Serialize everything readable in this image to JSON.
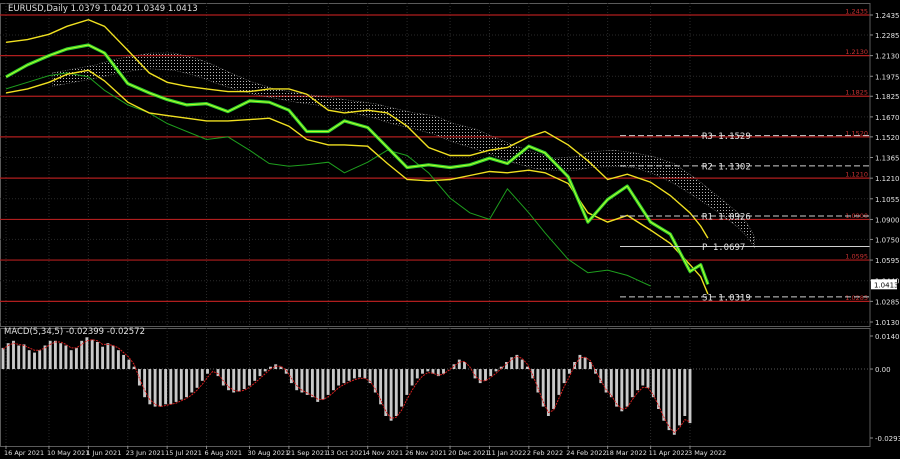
{
  "header": {
    "symbol_line": "EURUSD,Daily  1.0379 1.0420 1.0349 1.0413",
    "macd_line": "MACD(5,34,5) -0.02399 -0.02572"
  },
  "colors": {
    "background": "#000000",
    "grid": "#2a2a2a",
    "price": "#2fd02f",
    "price_highlight": "#b7ff2a",
    "bollinger": "#f0e020",
    "ichimoku_cloud": "#c8c8c8",
    "chikou": "#1e9e1e",
    "level_line": "#b01e1e",
    "level_label": "#c83232",
    "pivot_line": "#d0d0d0",
    "pivot_text": "#e0e0e0",
    "macd_hist": "#c8c8c8",
    "macd_signal": "#d82020",
    "axis_text": "#e0e0e0",
    "current_price_box": "#ffffff"
  },
  "chart_data": [
    {
      "type": "line",
      "panel": "price",
      "symbol": "EURUSD",
      "timeframe": "Daily",
      "ohlc_last": {
        "open": 1.0379,
        "high": 1.042,
        "low": 1.0349,
        "close": 1.0413
      },
      "current_price_label": "1.0413",
      "ylim": [
        1.013,
        1.2435
      ],
      "y_ticks": [
        "1.2435",
        "1.2285",
        "1.2130",
        "1.1975",
        "1.1825",
        "1.1670",
        "1.1520",
        "1.1365",
        "1.1210",
        "1.1055",
        "1.0900",
        "1.0750",
        "1.0595",
        "1.0440",
        "1.0285",
        "1.0130"
      ],
      "x_ticks": [
        "16 Apr 2021",
        "10 May 2021",
        "1 Jun 2021",
        "23 Jun 2021",
        "15 Jul 2021",
        "6 Aug 2021",
        "30 Aug 2021",
        "21 Sep 2021",
        "13 Oct 2021",
        "4 Nov 2021",
        "26 Nov 2021",
        "20 Dec 2021",
        "11 Jan 2022",
        "2 Feb 2022",
        "24 Feb 2022",
        "18 Mar 2022",
        "11 Apr 2022",
        "3 May 2022"
      ],
      "x_dates": [
        "2021-04-16",
        "2021-05-10",
        "2021-06-01",
        "2021-06-23",
        "2021-07-15",
        "2021-08-06",
        "2021-08-30",
        "2021-09-21",
        "2021-10-13",
        "2021-11-04",
        "2021-11-26",
        "2021-12-20",
        "2022-01-11",
        "2022-02-02",
        "2022-02-24",
        "2022-03-18",
        "2022-04-11",
        "2022-05-03"
      ],
      "close_series": {
        "dates": [
          "2021-04-16",
          "2021-04-28",
          "2021-05-10",
          "2021-05-20",
          "2021-06-01",
          "2021-06-10",
          "2021-06-23",
          "2021-07-05",
          "2021-07-15",
          "2021-07-26",
          "2021-08-06",
          "2021-08-18",
          "2021-08-30",
          "2021-09-10",
          "2021-09-21",
          "2021-10-01",
          "2021-10-13",
          "2021-10-22",
          "2021-11-04",
          "2021-11-15",
          "2021-11-26",
          "2021-12-08",
          "2021-12-20",
          "2021-12-31",
          "2022-01-11",
          "2022-01-21",
          "2022-02-02",
          "2022-02-11",
          "2022-02-24",
          "2022-03-07",
          "2022-03-18",
          "2022-03-29",
          "2022-04-11",
          "2022-04-22",
          "2022-05-03",
          "2022-05-09",
          "2022-05-13"
        ],
        "values": [
          1.197,
          1.206,
          1.213,
          1.218,
          1.221,
          1.215,
          1.192,
          1.185,
          1.18,
          1.176,
          1.177,
          1.171,
          1.179,
          1.178,
          1.172,
          1.156,
          1.156,
          1.164,
          1.159,
          1.144,
          1.129,
          1.131,
          1.129,
          1.131,
          1.136,
          1.132,
          1.145,
          1.14,
          1.122,
          1.088,
          1.105,
          1.115,
          1.088,
          1.079,
          1.051,
          1.056,
          1.0413
        ]
      },
      "bollinger_upper": [
        1.223,
        1.225,
        1.229,
        1.235,
        1.24,
        1.235,
        1.217,
        1.2,
        1.193,
        1.19,
        1.188,
        1.186,
        1.186,
        1.188,
        1.188,
        1.184,
        1.172,
        1.17,
        1.172,
        1.17,
        1.16,
        1.144,
        1.138,
        1.138,
        1.142,
        1.144,
        1.152,
        1.156,
        1.146,
        1.134,
        1.12,
        1.124,
        1.118,
        1.108,
        1.095,
        1.085,
        1.076
      ],
      "bollinger_lower": [
        1.185,
        1.188,
        1.193,
        1.199,
        1.202,
        1.194,
        1.178,
        1.17,
        1.168,
        1.166,
        1.164,
        1.164,
        1.165,
        1.166,
        1.16,
        1.15,
        1.146,
        1.146,
        1.145,
        1.132,
        1.12,
        1.119,
        1.12,
        1.123,
        1.126,
        1.125,
        1.127,
        1.125,
        1.117,
        1.095,
        1.088,
        1.093,
        1.082,
        1.072,
        1.056,
        1.047,
        1.034
      ],
      "cloud_top": [
        1.2,
        1.203,
        1.206,
        1.21,
        1.213,
        1.215,
        1.215,
        1.211,
        1.206,
        1.199,
        1.193,
        1.188,
        1.185,
        1.183,
        1.181,
        1.179,
        1.177,
        1.174,
        1.17,
        1.168,
        1.162,
        1.158,
        1.151,
        1.145,
        1.14,
        1.136,
        1.137,
        1.141,
        1.142,
        1.14,
        1.137,
        1.132,
        1.12,
        1.108,
        1.096,
        1.087,
        1.077
      ],
      "cloud_bottom": [
        1.19,
        1.193,
        1.196,
        1.199,
        1.202,
        1.203,
        1.202,
        1.198,
        1.193,
        1.188,
        1.184,
        1.181,
        1.178,
        1.176,
        1.173,
        1.17,
        1.166,
        1.162,
        1.158,
        1.154,
        1.148,
        1.143,
        1.137,
        1.132,
        1.128,
        1.127,
        1.127,
        1.129,
        1.13,
        1.129,
        1.124,
        1.117,
        1.106,
        1.096,
        1.085,
        1.077,
        1.069
      ],
      "chikou_series": [
        1.188,
        1.193,
        1.198,
        1.2,
        1.197,
        1.187,
        1.176,
        1.17,
        1.162,
        1.156,
        1.15,
        1.152,
        1.142,
        1.132,
        1.13,
        1.131,
        1.133,
        1.125,
        1.133,
        1.142,
        1.138,
        1.125,
        1.106,
        1.095,
        1.09,
        1.113,
        1.095,
        1.08,
        1.06,
        1.05,
        1.052,
        1.048,
        1.04
      ],
      "resistance_levels": [
        "1.2435",
        "1.2285",
        "1.2130",
        "1.1975",
        "1.1825",
        "1.1670",
        "1.1520",
        "1.1365",
        "1.1210",
        "1.1055",
        "1.0900",
        "1.0750",
        "1.0595",
        "1.0440",
        "1.0285",
        "1.0130"
      ],
      "pivot_levels": [
        {
          "label": "R3",
          "value": "1.1529"
        },
        {
          "label": "R2",
          "value": "1.1302"
        },
        {
          "label": "R1",
          "value": "1.0926"
        },
        {
          "label": "P",
          "value": "1.0697"
        },
        {
          "label": "S1",
          "value": "1.0319"
        }
      ]
    },
    {
      "type": "bar",
      "panel": "macd",
      "title": "MACD(5,34,5)",
      "macd_value": "-0.02399",
      "signal_value": "-0.02572",
      "ylim": [
        -0.02935,
        0.01406
      ],
      "y_ticks": [
        "0.01406",
        "0.00",
        "-0.02935"
      ],
      "hist": [
        0.009,
        0.011,
        0.012,
        0.01,
        0.0105,
        0.008,
        0.007,
        0.008,
        0.01,
        0.012,
        0.012,
        0.011,
        0.01,
        0.008,
        0.009,
        0.012,
        0.0135,
        0.0125,
        0.0115,
        0.0095,
        0.011,
        0.01,
        0.008,
        0.006,
        0.004,
        0.001,
        -0.007,
        -0.012,
        -0.015,
        -0.016,
        -0.016,
        -0.015,
        -0.015,
        -0.014,
        -0.013,
        -0.012,
        -0.01,
        -0.008,
        -0.005,
        -0.002,
        0.0,
        -0.003,
        -0.007,
        -0.009,
        -0.01,
        -0.0095,
        -0.0085,
        -0.007,
        -0.005,
        -0.003,
        -0.001,
        0.001,
        0.002,
        0.001,
        -0.002,
        -0.006,
        -0.009,
        -0.01,
        -0.011,
        -0.012,
        -0.014,
        -0.013,
        -0.011,
        -0.009,
        -0.007,
        -0.006,
        -0.005,
        -0.004,
        -0.0035,
        -0.004,
        -0.006,
        -0.01,
        -0.015,
        -0.02,
        -0.022,
        -0.02,
        -0.016,
        -0.011,
        -0.007,
        -0.004,
        -0.002,
        -0.001,
        -0.002,
        -0.003,
        -0.002,
        0.0,
        0.002,
        0.004,
        0.003,
        0.0,
        -0.004,
        -0.006,
        -0.005,
        -0.003,
        -0.001,
        0.001,
        0.003,
        0.005,
        0.006,
        0.004,
        0.001,
        -0.004,
        -0.01,
        -0.016,
        -0.02,
        -0.017,
        -0.011,
        -0.006,
        -0.002,
        0.003,
        0.006,
        0.005,
        0.003,
        -0.002,
        -0.006,
        -0.01,
        -0.012,
        -0.016,
        -0.018,
        -0.016,
        -0.012,
        -0.009,
        -0.007,
        -0.008,
        -0.012,
        -0.017,
        -0.022,
        -0.026,
        -0.028,
        -0.024,
        -0.02,
        -0.023
      ],
      "signal": [
        0.0085,
        0.01,
        0.011,
        0.0105,
        0.01,
        0.009,
        0.008,
        0.008,
        0.009,
        0.0105,
        0.0115,
        0.0115,
        0.0105,
        0.009,
        0.009,
        0.0105,
        0.012,
        0.0125,
        0.012,
        0.0105,
        0.0105,
        0.01,
        0.009,
        0.007,
        0.005,
        0.002,
        -0.004,
        -0.009,
        -0.013,
        -0.015,
        -0.016,
        -0.0155,
        -0.015,
        -0.0145,
        -0.0135,
        -0.0125,
        -0.011,
        -0.009,
        -0.0065,
        -0.0035,
        -0.001,
        -0.002,
        -0.005,
        -0.0075,
        -0.009,
        -0.0095,
        -0.009,
        -0.0078,
        -0.006,
        -0.004,
        -0.002,
        0.0,
        0.0012,
        0.0012,
        -0.0005,
        -0.004,
        -0.007,
        -0.009,
        -0.0102,
        -0.0112,
        -0.0128,
        -0.013,
        -0.0118,
        -0.01,
        -0.008,
        -0.0066,
        -0.0055,
        -0.0046,
        -0.004,
        -0.004,
        -0.0052,
        -0.0085,
        -0.013,
        -0.018,
        -0.021,
        -0.0205,
        -0.0175,
        -0.013,
        -0.009,
        -0.0055,
        -0.003,
        -0.0015,
        -0.0018,
        -0.0026,
        -0.0022,
        -0.0005,
        0.0012,
        0.003,
        0.0032,
        0.001,
        -0.0028,
        -0.005,
        -0.005,
        -0.0036,
        -0.0018,
        0.0002,
        0.0022,
        0.004,
        0.0054,
        0.0045,
        0.002,
        -0.0025,
        -0.008,
        -0.014,
        -0.0185,
        -0.0175,
        -0.0125,
        -0.0075,
        -0.0032,
        0.0015,
        0.0048,
        0.005,
        0.0036,
        -0.0008,
        -0.0048,
        -0.0088,
        -0.0112,
        -0.0148,
        -0.0172,
        -0.0165,
        -0.013,
        -0.01,
        -0.0078,
        -0.008,
        -0.011,
        -0.0155,
        -0.0205,
        -0.0245,
        -0.027,
        -0.025,
        -0.0215,
        -0.0225
      ]
    }
  ]
}
